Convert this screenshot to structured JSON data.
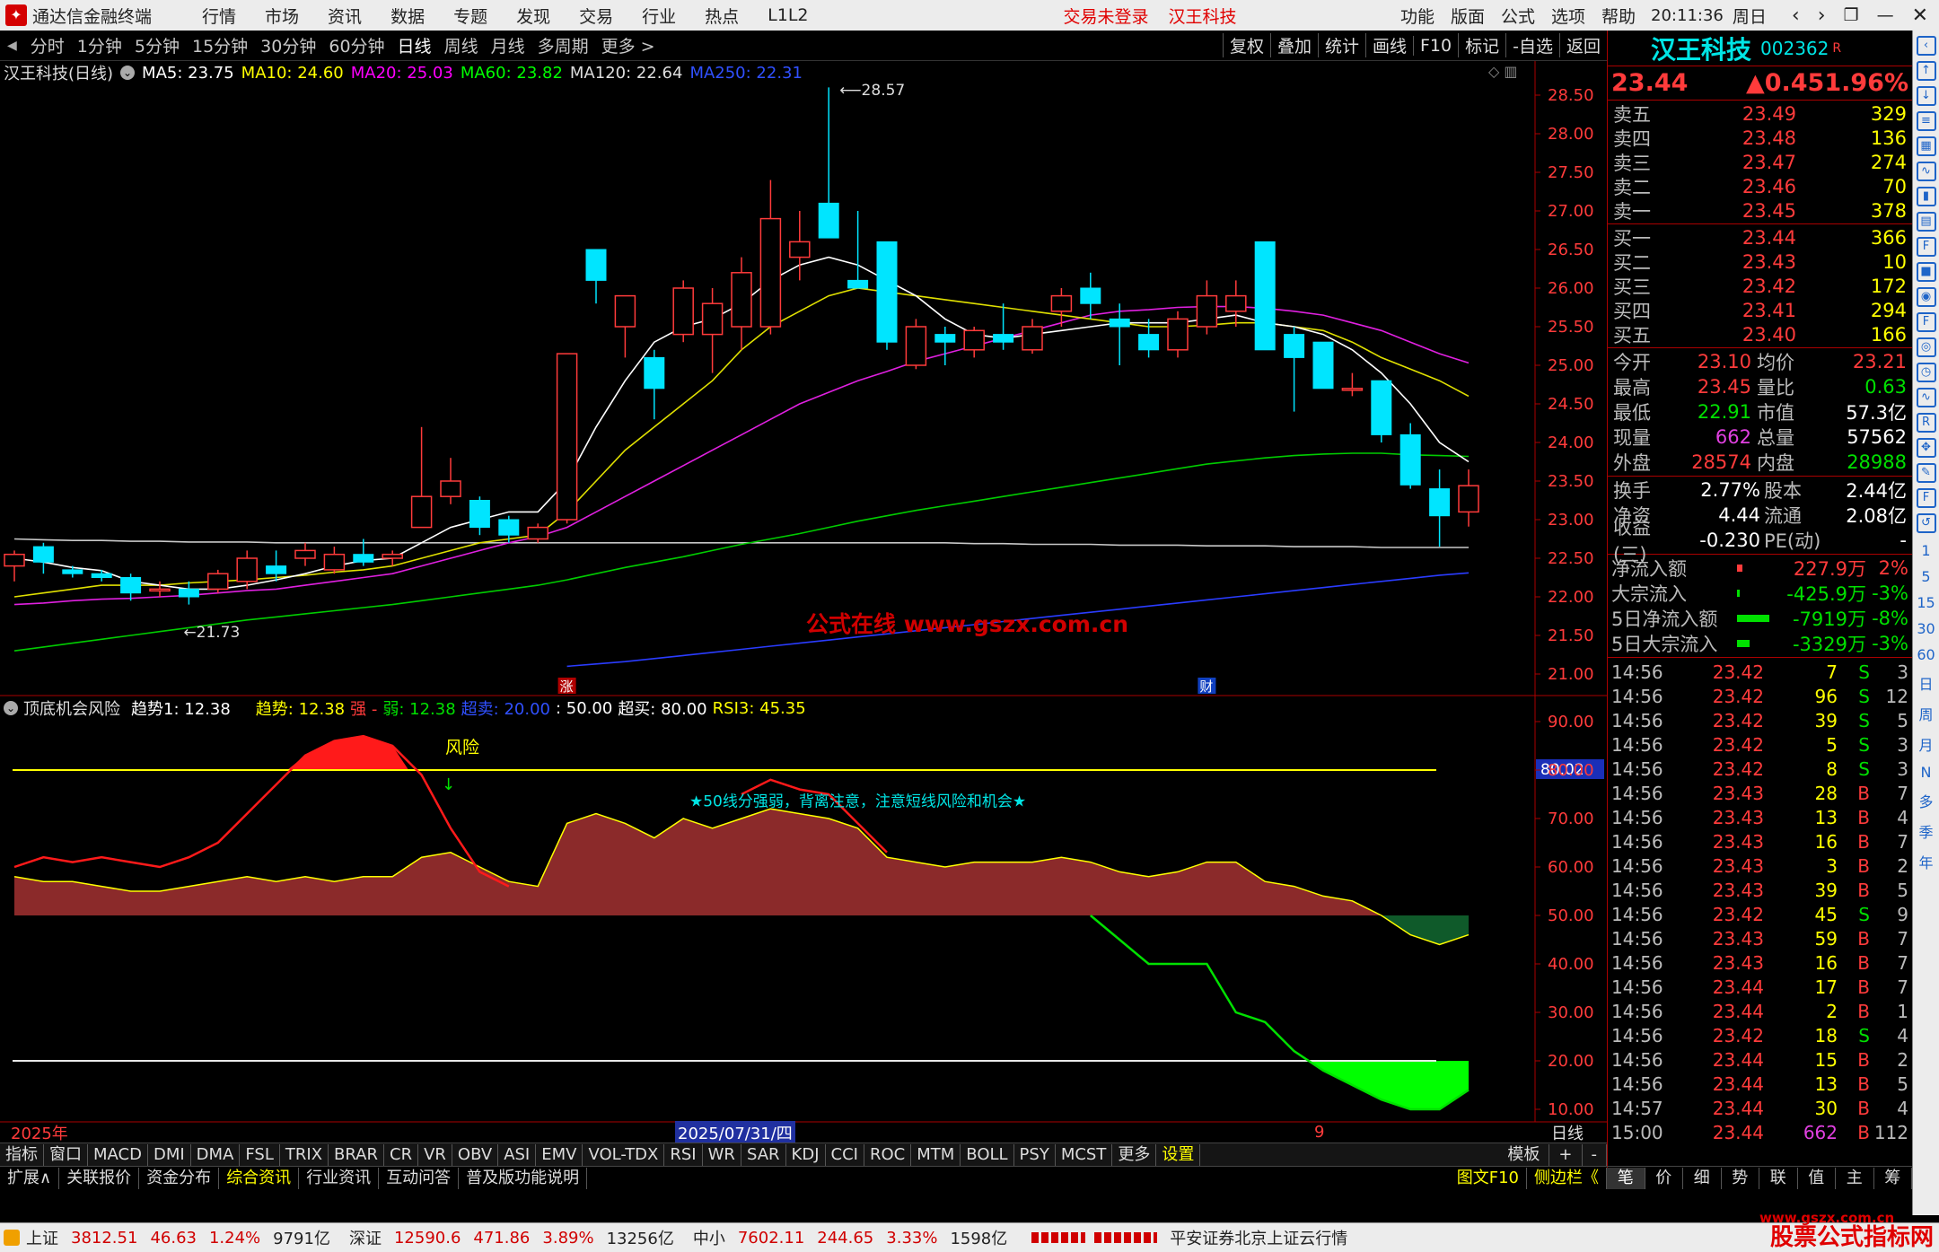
{
  "app": {
    "title": "通达信金融终端",
    "clock": "20:11:36",
    "weekday": "周日",
    "login_status": "交易未登录",
    "stock_name_red": "汉王科技"
  },
  "menu": {
    "left": [
      "行情",
      "市场",
      "资讯",
      "数据",
      "专题",
      "发现",
      "交易",
      "行业",
      "热点",
      "L1L2"
    ],
    "right": [
      "功能",
      "版面",
      "公式",
      "选项",
      "帮助"
    ]
  },
  "periods": [
    "分时",
    "1分钟",
    "5分钟",
    "15分钟",
    "30分钟",
    "60分钟",
    "日线",
    "周线",
    "月线",
    "多周期",
    "更多 >"
  ],
  "selected_period": "日线",
  "tools": [
    "复权",
    "叠加",
    "统计",
    "画线",
    "F10",
    "标记",
    "-自选",
    "返回"
  ],
  "chart_header": {
    "name": "汉王科技(日线)",
    "ma": [
      {
        "label": "MA5: 23.75",
        "color": "#ffffff"
      },
      {
        "label": "MA10: 24.60",
        "color": "#ffff00"
      },
      {
        "label": "MA20: 25.03",
        "color": "#ff00ff"
      },
      {
        "label": "MA60: 23.82",
        "color": "#00ff00"
      },
      {
        "label": "MA120: 22.64",
        "color": "#dddddd"
      },
      {
        "label": "MA250: 22.31",
        "color": "#3050ff"
      }
    ]
  },
  "indicator_header": {
    "name": "顶底机会风险",
    "items": [
      {
        "label": "趋势1: 12.38",
        "color": "#ffffff"
      },
      {
        "label": "趋势: 12.38",
        "color": "#ffff00"
      },
      {
        "label": "强 -",
        "color": "#ff3b3b"
      },
      {
        "label": "弱: 12.38",
        "color": "#00e000"
      },
      {
        "label": "超卖: 20.00",
        "color": "#3050ff"
      },
      {
        "label": ": 50.00",
        "color": "#ffffff"
      },
      {
        "label": "超买: 80.00",
        "color": "#ffffff"
      },
      {
        "label": "RSI3: 45.35",
        "color": "#ffff00"
      }
    ]
  },
  "chart_data": {
    "type": "candlestick",
    "price_axis_ticks": [
      "28.50",
      "28.00",
      "27.50",
      "27.00",
      "26.50",
      "26.00",
      "25.50",
      "25.00",
      "24.50",
      "24.00",
      "23.50",
      "23.00",
      "22.50",
      "22.00",
      "21.50",
      "21.00"
    ],
    "candles": [
      [
        22.4,
        22.6,
        22.2,
        22.55
      ],
      [
        22.65,
        22.7,
        22.3,
        22.45
      ],
      [
        22.35,
        22.4,
        22.25,
        22.3
      ],
      [
        22.3,
        22.35,
        22.2,
        22.25
      ],
      [
        22.25,
        22.3,
        21.95,
        22.05
      ],
      [
        22.1,
        22.2,
        22.0,
        22.1
      ],
      [
        22.1,
        22.2,
        21.9,
        22.0
      ],
      [
        22.1,
        22.35,
        22.05,
        22.3
      ],
      [
        22.2,
        22.6,
        22.1,
        22.5
      ],
      [
        22.4,
        22.6,
        22.2,
        22.3
      ],
      [
        22.5,
        22.7,
        22.4,
        22.6
      ],
      [
        22.35,
        22.65,
        22.3,
        22.55
      ],
      [
        22.55,
        22.75,
        22.4,
        22.45
      ],
      [
        22.5,
        22.6,
        22.4,
        22.55
      ],
      [
        22.9,
        24.2,
        22.9,
        23.3
      ],
      [
        23.3,
        23.8,
        23.2,
        23.5
      ],
      [
        23.25,
        23.3,
        22.8,
        22.9
      ],
      [
        23.0,
        23.05,
        22.7,
        22.8
      ],
      [
        22.75,
        22.95,
        22.7,
        22.9
      ],
      [
        23.0,
        25.15,
        22.95,
        25.15
      ],
      [
        26.5,
        26.45,
        25.8,
        26.1
      ],
      [
        25.5,
        25.9,
        25.1,
        25.9
      ],
      [
        25.1,
        25.2,
        24.3,
        24.7
      ],
      [
        25.4,
        26.1,
        25.3,
        26.0
      ],
      [
        25.4,
        26.0,
        24.9,
        25.8
      ],
      [
        25.5,
        26.4,
        25.2,
        26.2
      ],
      [
        25.5,
        27.4,
        25.4,
        26.9
      ],
      [
        26.4,
        27.0,
        26.1,
        26.6
      ],
      [
        27.1,
        28.6,
        26.9,
        26.65
      ],
      [
        26.1,
        27.0,
        26.0,
        26.0
      ],
      [
        26.6,
        26.5,
        25.2,
        25.3
      ],
      [
        25.0,
        25.6,
        24.95,
        25.5
      ],
      [
        25.4,
        25.5,
        25.0,
        25.3
      ],
      [
        25.2,
        25.5,
        25.1,
        25.45
      ],
      [
        25.4,
        25.8,
        25.2,
        25.3
      ],
      [
        25.2,
        25.6,
        25.15,
        25.5
      ],
      [
        25.7,
        26.0,
        25.5,
        25.9
      ],
      [
        26.0,
        26.2,
        25.6,
        25.8
      ],
      [
        25.6,
        25.8,
        25.0,
        25.5
      ],
      [
        25.4,
        25.6,
        25.1,
        25.2
      ],
      [
        25.2,
        25.7,
        25.1,
        25.6
      ],
      [
        25.5,
        26.1,
        25.4,
        25.9
      ],
      [
        25.7,
        26.1,
        25.5,
        25.9
      ],
      [
        26.6,
        26.6,
        25.2,
        25.2
      ],
      [
        25.4,
        25.5,
        24.4,
        25.1
      ],
      [
        25.3,
        25.3,
        24.7,
        24.7
      ],
      [
        24.7,
        24.9,
        24.6,
        24.7
      ],
      [
        24.8,
        24.8,
        24.0,
        24.1
      ],
      [
        24.1,
        24.25,
        23.4,
        23.45
      ],
      [
        23.4,
        23.65,
        22.65,
        23.05
      ],
      [
        23.1,
        23.65,
        22.91,
        23.44
      ]
    ],
    "ma5": [
      22.5,
      22.45,
      22.38,
      22.34,
      22.2,
      22.15,
      22.1,
      22.1,
      22.15,
      22.22,
      22.3,
      22.4,
      22.47,
      22.5,
      22.7,
      22.9,
      23.0,
      23.1,
      23.1,
      23.5,
      24.2,
      24.8,
      25.3,
      25.5,
      25.6,
      25.8,
      26.1,
      26.3,
      26.4,
      26.3,
      26.1,
      25.9,
      25.6,
      25.4,
      25.35,
      25.4,
      25.45,
      25.5,
      25.55,
      25.55,
      25.55,
      25.6,
      25.65,
      25.55,
      25.5,
      25.4,
      25.2,
      24.9,
      24.5,
      24.0,
      23.75
    ],
    "ma10": [
      22.0,
      22.05,
      22.1,
      22.15,
      22.15,
      22.15,
      22.18,
      22.2,
      22.22,
      22.25,
      22.28,
      22.32,
      22.35,
      22.4,
      22.5,
      22.6,
      22.7,
      22.75,
      22.8,
      23.1,
      23.5,
      23.9,
      24.2,
      24.5,
      24.8,
      25.2,
      25.5,
      25.7,
      25.9,
      26.0,
      25.95,
      25.9,
      25.85,
      25.8,
      25.75,
      25.7,
      25.65,
      25.6,
      25.55,
      25.5,
      25.5,
      25.52,
      25.55,
      25.55,
      25.5,
      25.45,
      25.3,
      25.1,
      24.95,
      24.8,
      24.6
    ],
    "ma20": [
      21.9,
      21.92,
      21.95,
      21.97,
      21.98,
      22.0,
      22.02,
      22.05,
      22.08,
      22.1,
      22.15,
      22.2,
      22.25,
      22.3,
      22.4,
      22.5,
      22.6,
      22.7,
      22.78,
      22.9,
      23.1,
      23.3,
      23.5,
      23.7,
      23.9,
      24.1,
      24.3,
      24.5,
      24.65,
      24.8,
      24.92,
      25.05,
      25.15,
      25.25,
      25.35,
      25.45,
      25.55,
      25.65,
      25.7,
      25.72,
      25.75,
      25.76,
      25.76,
      25.74,
      25.7,
      25.65,
      25.55,
      25.45,
      25.3,
      25.15,
      25.03
    ],
    "ma60": [
      21.3,
      21.35,
      21.4,
      21.45,
      21.5,
      21.55,
      21.6,
      21.65,
      21.7,
      21.74,
      21.78,
      21.82,
      21.86,
      21.9,
      21.95,
      22.0,
      22.05,
      22.1,
      22.15,
      22.22,
      22.3,
      22.38,
      22.45,
      22.52,
      22.6,
      22.68,
      22.75,
      22.82,
      22.9,
      22.98,
      23.05,
      23.12,
      23.18,
      23.24,
      23.3,
      23.36,
      23.42,
      23.48,
      23.54,
      23.6,
      23.66,
      23.72,
      23.76,
      23.8,
      23.83,
      23.85,
      23.86,
      23.86,
      23.84,
      23.83,
      23.82
    ],
    "ma120": [
      22.75,
      22.74,
      22.73,
      22.73,
      22.72,
      22.72,
      22.71,
      22.71,
      22.71,
      22.7,
      22.7,
      22.7,
      22.7,
      22.7,
      22.7,
      22.7,
      22.7,
      22.7,
      22.7,
      22.7,
      22.7,
      22.7,
      22.7,
      22.7,
      22.7,
      22.7,
      22.7,
      22.7,
      22.7,
      22.7,
      22.7,
      22.7,
      22.7,
      22.69,
      22.69,
      22.68,
      22.68,
      22.68,
      22.67,
      22.67,
      22.67,
      22.66,
      22.66,
      22.66,
      22.65,
      22.65,
      22.65,
      22.64,
      22.64,
      22.64,
      22.64
    ],
    "ma250": [
      null,
      null,
      null,
      null,
      null,
      null,
      null,
      null,
      null,
      null,
      null,
      null,
      null,
      null,
      null,
      null,
      null,
      null,
      null,
      21.1,
      21.13,
      21.16,
      21.2,
      21.24,
      21.28,
      21.32,
      21.36,
      21.4,
      21.44,
      21.48,
      21.52,
      21.56,
      21.6,
      21.64,
      21.68,
      21.72,
      21.76,
      21.8,
      21.84,
      21.88,
      21.92,
      21.96,
      22.0,
      22.04,
      22.08,
      22.12,
      22.16,
      22.2,
      22.24,
      22.28,
      22.31
    ],
    "annotations": [
      "28.57",
      "21.73",
      "公式在线 www.gszx.com.cn",
      "涨",
      "财"
    ],
    "indicator": {
      "y_ticks": [
        "90.00",
        "80.00",
        "70.00",
        "60.00",
        "50.00",
        "40.00",
        "30.00",
        "20.00",
        "10.00"
      ],
      "overbought": 80,
      "oversold": 20,
      "middle": 50,
      "last_value_tag": "80.02",
      "risk_label": "风险",
      "note": "★50线分强弱，背离注意，注意短线风险和机会★",
      "trend": [
        58,
        57,
        57,
        56,
        55,
        55,
        56,
        57,
        58,
        57,
        58,
        57,
        58,
        58,
        62,
        63,
        60,
        57,
        56,
        69,
        71,
        69,
        66,
        70,
        68,
        70,
        72,
        71,
        70,
        68,
        62,
        61,
        60,
        61,
        61,
        61,
        62,
        61,
        59,
        58,
        59,
        61,
        61,
        57,
        56,
        54,
        53,
        50,
        46,
        44,
        46
      ],
      "strong": [
        60,
        62,
        61,
        62,
        61,
        60,
        62,
        65,
        71,
        77,
        83,
        86,
        87,
        85,
        79,
        68,
        59,
        56,
        null,
        null,
        null,
        null,
        null,
        null,
        null,
        75,
        78,
        76,
        75,
        69,
        63,
        null,
        null,
        null,
        null,
        null,
        null,
        null,
        null,
        null,
        null,
        null,
        null,
        null,
        null,
        null,
        null,
        null,
        null,
        null,
        null
      ],
      "weak": [
        null,
        null,
        null,
        null,
        null,
        null,
        null,
        null,
        null,
        null,
        null,
        null,
        null,
        null,
        null,
        null,
        null,
        null,
        null,
        null,
        null,
        null,
        null,
        null,
        null,
        null,
        null,
        null,
        null,
        null,
        null,
        null,
        null,
        null,
        null,
        null,
        null,
        50,
        45,
        40,
        40,
        40,
        30,
        28,
        22,
        18,
        15,
        12,
        10,
        10,
        14
      ]
    }
  },
  "time_axis": {
    "start": "2025年",
    "mid": "2025/07/31/四",
    "right_marker": "9",
    "scale": "日线"
  },
  "quote": {
    "name": "汉王科技",
    "code": "002362",
    "tag": "R",
    "price": "23.44",
    "change": "▲0.45",
    "pct": "1.96%",
    "asks": [
      {
        "label": "卖五",
        "price": "23.49",
        "vol": "329"
      },
      {
        "label": "卖四",
        "price": "23.48",
        "vol": "136"
      },
      {
        "label": "卖三",
        "price": "23.47",
        "vol": "274"
      },
      {
        "label": "卖二",
        "price": "23.46",
        "vol": "70"
      },
      {
        "label": "卖一",
        "price": "23.45",
        "vol": "378"
      }
    ],
    "bids": [
      {
        "label": "买一",
        "price": "23.44",
        "vol": "366"
      },
      {
        "label": "买二",
        "price": "23.43",
        "vol": "10"
      },
      {
        "label": "买三",
        "price": "23.42",
        "vol": "172"
      },
      {
        "label": "买四",
        "price": "23.41",
        "vol": "294"
      },
      {
        "label": "买五",
        "price": "23.40",
        "vol": "166"
      }
    ],
    "stats1": [
      {
        "k1": "今开",
        "v1": "23.10",
        "c1": "red",
        "k2": "均价",
        "v2": "23.21",
        "c2": "red"
      },
      {
        "k1": "最高",
        "v1": "23.45",
        "c1": "red",
        "k2": "量比",
        "v2": "0.63",
        "c2": "grn"
      },
      {
        "k1": "最低",
        "v1": "22.91",
        "c1": "grn",
        "k2": "市值",
        "v2": "57.3亿",
        "c2": "wht"
      },
      {
        "k1": "现量",
        "v1": "662",
        "c1": "mag",
        "k2": "总量",
        "v2": "57562",
        "c2": "wht"
      },
      {
        "k1": "外盘",
        "v1": "28574",
        "c1": "red",
        "k2": "内盘",
        "v2": "28988",
        "c2": "grn"
      }
    ],
    "stats2": [
      {
        "k1": "换手",
        "v1": "2.77%",
        "k2": "股本",
        "v2": "2.44亿"
      },
      {
        "k1": "净资",
        "v1": "4.44",
        "k2": "流通",
        "v2": "2.08亿"
      },
      {
        "k1": "收益(三)",
        "v1": "-0.230",
        "k2": "PE(动)",
        "v2": "-"
      }
    ],
    "flows": [
      {
        "k": "净流入额",
        "v": "227.9万",
        "p": "2%",
        "c": "red",
        "bar": 6
      },
      {
        "k": "大宗流入",
        "v": "-425.9万",
        "p": "-3%",
        "c": "grn",
        "bar": 3
      },
      {
        "k": "5日净流入额",
        "v": "-7919万",
        "p": "-8%",
        "c": "grn",
        "bar": 36
      },
      {
        "k": "5日大宗流入",
        "v": "-3329万",
        "p": "-3%",
        "c": "grn",
        "bar": 14
      }
    ],
    "ticks": [
      {
        "t": "14:56",
        "p": "23.42",
        "v": "7",
        "d": "S",
        "n": "3"
      },
      {
        "t": "14:56",
        "p": "23.42",
        "v": "96",
        "d": "S",
        "n": "12"
      },
      {
        "t": "14:56",
        "p": "23.42",
        "v": "39",
        "d": "S",
        "n": "5"
      },
      {
        "t": "14:56",
        "p": "23.42",
        "v": "5",
        "d": "S",
        "n": "3"
      },
      {
        "t": "14:56",
        "p": "23.42",
        "v": "8",
        "d": "S",
        "n": "3"
      },
      {
        "t": "14:56",
        "p": "23.43",
        "v": "28",
        "d": "B",
        "n": "7"
      },
      {
        "t": "14:56",
        "p": "23.43",
        "v": "13",
        "d": "B",
        "n": "4"
      },
      {
        "t": "14:56",
        "p": "23.43",
        "v": "16",
        "d": "B",
        "n": "7"
      },
      {
        "t": "14:56",
        "p": "23.43",
        "v": "3",
        "d": "B",
        "n": "2"
      },
      {
        "t": "14:56",
        "p": "23.43",
        "v": "39",
        "d": "B",
        "n": "5"
      },
      {
        "t": "14:56",
        "p": "23.42",
        "v": "45",
        "d": "S",
        "n": "9"
      },
      {
        "t": "14:56",
        "p": "23.43",
        "v": "59",
        "d": "B",
        "n": "7"
      },
      {
        "t": "14:56",
        "p": "23.43",
        "v": "16",
        "d": "B",
        "n": "7"
      },
      {
        "t": "14:56",
        "p": "23.44",
        "v": "17",
        "d": "B",
        "n": "7"
      },
      {
        "t": "14:56",
        "p": "23.44",
        "v": "2",
        "d": "B",
        "n": "1"
      },
      {
        "t": "14:56",
        "p": "23.42",
        "v": "18",
        "d": "S",
        "n": "4"
      },
      {
        "t": "14:56",
        "p": "23.44",
        "v": "15",
        "d": "B",
        "n": "2"
      },
      {
        "t": "14:56",
        "p": "23.44",
        "v": "13",
        "d": "B",
        "n": "5"
      },
      {
        "t": "14:57",
        "p": "23.44",
        "v": "30",
        "d": "B",
        "n": "4"
      },
      {
        "t": "15:00",
        "p": "23.44",
        "v": "662",
        "d": "B",
        "n": "112"
      }
    ]
  },
  "bottom_tabs1": [
    "指标",
    "窗口",
    "MACD",
    "DMI",
    "DMA",
    "FSL",
    "TRIX",
    "BRAR",
    "CR",
    "VR",
    "OBV",
    "ASI",
    "EMV",
    "VOL-TDX",
    "RSI",
    "WR",
    "SAR",
    "KDJ",
    "CCI",
    "ROC",
    "MTM",
    "BOLL",
    "PSY",
    "MCST",
    "更多",
    "设置"
  ],
  "bottom_tabs1_right": [
    "模板",
    "+",
    "-"
  ],
  "bottom_tabs2": [
    "扩展∧",
    "关联报价",
    "资金分布",
    "综合资讯",
    "行业资讯",
    "互动问答",
    "普及版功能说明"
  ],
  "bottom_tabs2_right": [
    "图文F10",
    "侧边栏《"
  ],
  "right_tabs": [
    "笔",
    "价",
    "细",
    "势",
    "联",
    "值",
    "主",
    "筹"
  ],
  "side_text": [
    "1",
    "5",
    "15",
    "30",
    "60",
    "日",
    "周",
    "月",
    "N",
    "多",
    "季",
    "年"
  ],
  "side_icons": [
    "collapse-icon",
    "up-arrow-icon",
    "down-arrow-icon",
    "list-icon",
    "grid-icon",
    "line-chart-icon",
    "candle-icon",
    "table-icon",
    "f10-icon",
    "news-icon",
    "bell-icon",
    "f2-icon",
    "chat-icon",
    "clock-icon",
    "rsi-chart-icon",
    "rsi-icon",
    "move-icon",
    "pen-icon",
    "fs-icon",
    "history-icon"
  ],
  "status": {
    "sh_name": "上证",
    "sh_val": "3812.51",
    "sh_chg": "46.63",
    "sh_pct": "1.24%",
    "sh_amt": "9791亿",
    "sz_name": "深证",
    "sz_val": "12590.6",
    "sz_chg": "471.86",
    "sz_pct": "3.89%",
    "sz_amt": "13256亿",
    "zx_name": "中小",
    "zx_val": "7602.11",
    "zx_chg": "244.65",
    "zx_pct": "3.33%",
    "zx_amt": "1598亿",
    "broker": "平安证券北京上证云行情",
    "watermark": "股票公式指标网",
    "watermark_url": "www.gszx.com.cn"
  }
}
